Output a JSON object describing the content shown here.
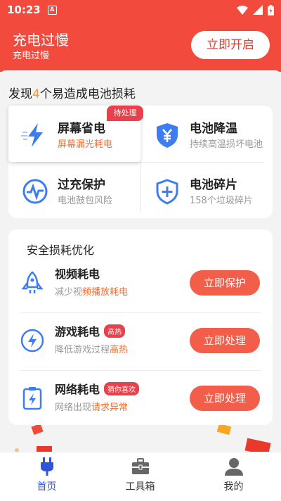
{
  "status_bar": {
    "time": "10:23",
    "notification_glyph": "A"
  },
  "header": {
    "title": "充电过慢",
    "subtitle": "充电过慢",
    "action_label": "立即开启"
  },
  "issues_heading": {
    "prefix": "发现",
    "count": "4",
    "suffix": "个易造成电池损耗"
  },
  "issues": [
    {
      "name": "屏幕省电",
      "desc": "屏幕漏光耗电",
      "badge": "待处理",
      "icon": "lightning-icon",
      "accent": "#3d7df0"
    },
    {
      "name": "电池降温",
      "desc": "持续高温损坏电池",
      "icon": "shield-yen-icon",
      "accent": "#3d7df0"
    },
    {
      "name": "过充保护",
      "desc": "电池鼓包风险",
      "icon": "pulse-icon",
      "accent": "#3d7df0"
    },
    {
      "name": "电池碎片",
      "desc": "158个垃圾碎片",
      "icon": "shield-plus-icon",
      "accent": "#3d7df0"
    }
  ],
  "optimize": {
    "title": "安全损耗优化",
    "rows": [
      {
        "name": "视频耗电",
        "tag": "",
        "desc_plain": "减少视",
        "desc_hl": "频播放耗电",
        "button": "立即保护",
        "icon": "rocket-icon"
      },
      {
        "name": "游戏耗电",
        "tag": "高热",
        "desc_plain": "降低游戏过程",
        "desc_hl": "高热",
        "button": "立即处理",
        "icon": "bolt-circle-icon"
      },
      {
        "name": "网络耗电",
        "tag": "猜你喜欢",
        "desc_plain": "网络出现",
        "desc_hl": "请求异常",
        "button": "立即处理",
        "icon": "clipboard-bolt-icon"
      }
    ]
  },
  "tabs": [
    {
      "label": "首页",
      "icon": "plug-icon",
      "active": true
    },
    {
      "label": "工具箱",
      "icon": "toolbox-icon",
      "active": false
    },
    {
      "label": "我的",
      "icon": "user-icon",
      "active": false
    }
  ],
  "colors": {
    "brand": "#f24a3d",
    "accent_blue": "#2f54d6",
    "highlight": "#ff6a2a",
    "button": "#f25e4a"
  }
}
